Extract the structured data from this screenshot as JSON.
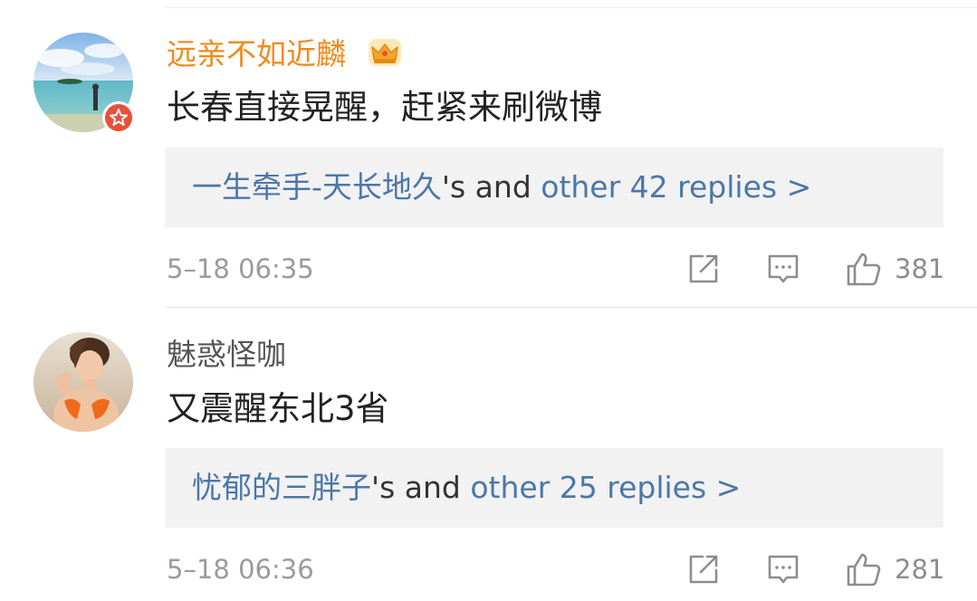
{
  "comments": [
    {
      "username": "远亲不如近麟",
      "username_color": "#f28a1d",
      "has_crown_badge": true,
      "has_verified_badge": true,
      "text": "长春直接晃醒，赶紧来刷微博",
      "reply_user": "一生牵手-天长地久",
      "reply_mid": "'s and ",
      "reply_count_text": "other 42 replies >",
      "timestamp": "5–18 06:35",
      "likes": "381"
    },
    {
      "username": "魅惑怪咖",
      "username_color": "#555555",
      "has_crown_badge": false,
      "has_verified_badge": false,
      "text": "又震醒东北3省",
      "reply_user": "忧郁的三胖子",
      "reply_mid": "'s and ",
      "reply_count_text": "other 25 replies >",
      "timestamp": "5–18 06:36",
      "likes": "281"
    }
  ],
  "icons": {
    "share": "share-icon",
    "comment": "comment-icon",
    "like": "thumbs-up-icon",
    "crown": "crown-badge-icon",
    "verified": "verified-badge-icon"
  },
  "colors": {
    "link": "#4b77a8",
    "reply_bg": "#f2f2f2",
    "timestamp": "#9b9b9b",
    "badge_red": "#e8503a"
  }
}
